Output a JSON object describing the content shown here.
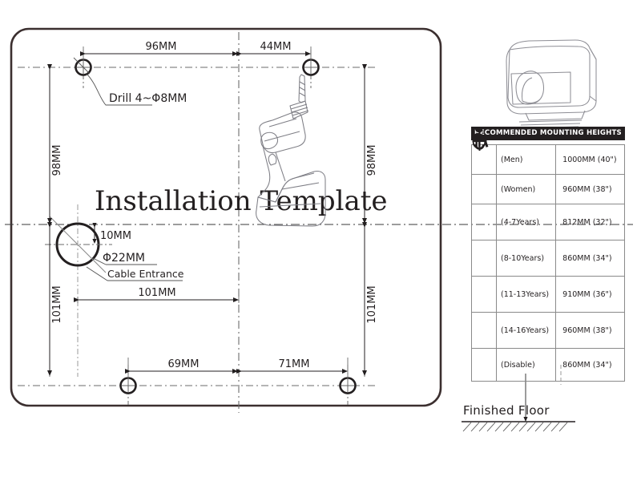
{
  "template": {
    "title": "Installation Template",
    "dimensions": {
      "top_left": "96MM",
      "top_right": "44MM",
      "bottom_left": "69MM",
      "bottom_right": "71MM",
      "left_upper": "98MM",
      "left_lower": "101MM",
      "right_upper": "98MM",
      "right_lower": "101MM",
      "cable_horizontal": "101MM",
      "cable_offset": "10MM"
    },
    "annotations": {
      "drill": "Drill 4~Φ8MM",
      "cable_diameter": "Φ22MM",
      "cable_entrance": "Cable Entrance"
    }
  },
  "illustrations": {
    "dryer": "hand-dryer-illustration",
    "drill": "power-drill-illustration"
  },
  "floor": {
    "label": "Finished Floor"
  },
  "mounting_table": {
    "header": "RECOMMENDED MOUNTING HEIGHTS",
    "rows": [
      {
        "icon": "man-icon",
        "label": "(Men)",
        "height": "1000MM (40\")"
      },
      {
        "icon": "woman-icon",
        "label": "(Women)",
        "height": "960MM (38\")"
      },
      {
        "icon": "child-icon",
        "label": "(4-7Years)",
        "height": "812MM (32\")"
      },
      {
        "icon": "child-icon",
        "label": "(8-10Years)",
        "height": "860MM (34\")"
      },
      {
        "icon": "child-icon",
        "label": "(11-13Years)",
        "height": "910MM (36\")"
      },
      {
        "icon": "child-icon",
        "label": "(14-16Years)",
        "height": "960MM (38\")"
      },
      {
        "icon": "wheelchair-icon",
        "label": "(Disable)",
        "height": "860MM (34\")"
      }
    ]
  },
  "colors": {
    "ink": "#231f20",
    "rule": "#8a8a8a",
    "header_bg": "#231f20"
  }
}
